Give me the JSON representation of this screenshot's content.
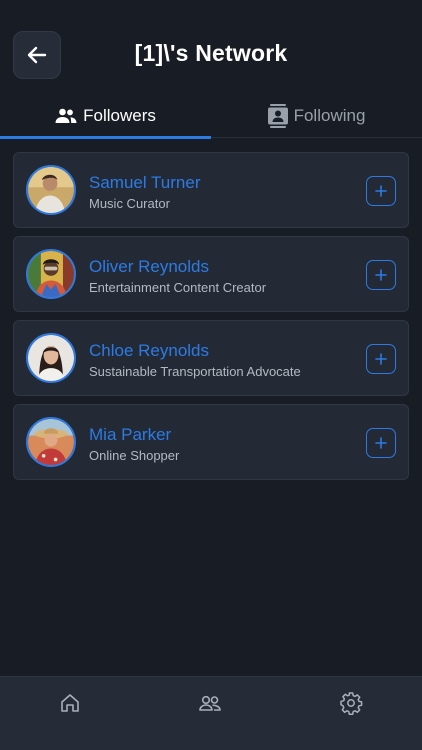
{
  "header": {
    "title": "[1]\\'s Network",
    "back_icon": "arrow-left-icon"
  },
  "tabs": [
    {
      "label": "Followers",
      "icon": "people-icon",
      "active": true
    },
    {
      "label": "Following",
      "icon": "contact-card-icon",
      "active": false
    }
  ],
  "followers": [
    {
      "name": "Samuel Turner",
      "role": "Music Curator",
      "action_icon": "plus-icon"
    },
    {
      "name": "Oliver Reynolds",
      "role": "Entertainment Content Creator",
      "action_icon": "plus-icon"
    },
    {
      "name": "Chloe Reynolds",
      "role": "Sustainable Transportation Advocate",
      "action_icon": "plus-icon"
    },
    {
      "name": "Mia Parker",
      "role": "Online Shopper",
      "action_icon": "plus-icon"
    }
  ],
  "bottom_nav": [
    {
      "icon": "home-icon"
    },
    {
      "icon": "people-icon"
    },
    {
      "icon": "gear-icon"
    }
  ],
  "colors": {
    "background": "#181d25",
    "card": "#232a35",
    "accent": "#2c7be5",
    "text_primary": "#ffffff",
    "text_secondary": "#b4b9c1"
  }
}
